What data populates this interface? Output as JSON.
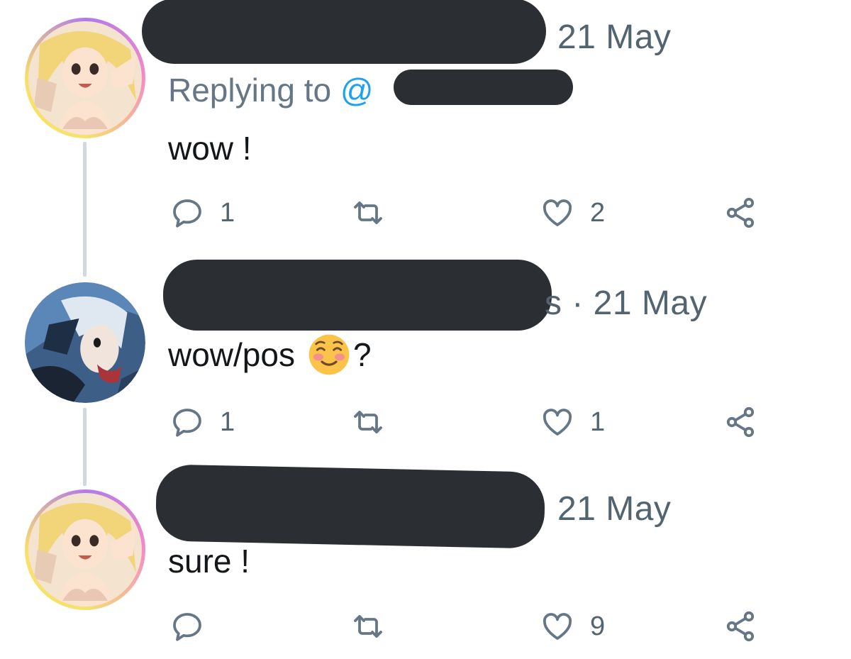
{
  "tweets": [
    {
      "date": "21 May",
      "replying_to_prefix": "Replying to ",
      "replying_to_handle": "@",
      "text": "wow !",
      "reply_count": "1",
      "retweet_count": "",
      "like_count": "2"
    },
    {
      "date": "s · 21 May",
      "text": "wow/pos",
      "text_suffix": "?",
      "emoji": "smiling-face-with-blush-emoji",
      "reply_count": "1",
      "retweet_count": "",
      "like_count": "1"
    },
    {
      "date": "21 May",
      "text": "sure !",
      "reply_count": "",
      "retweet_count": "",
      "like_count": "9"
    }
  ],
  "colors": {
    "redaction": "#2b2e33",
    "secondary_text": "#657786",
    "link": "#1da1f2",
    "thread_line": "#cfd9de"
  }
}
